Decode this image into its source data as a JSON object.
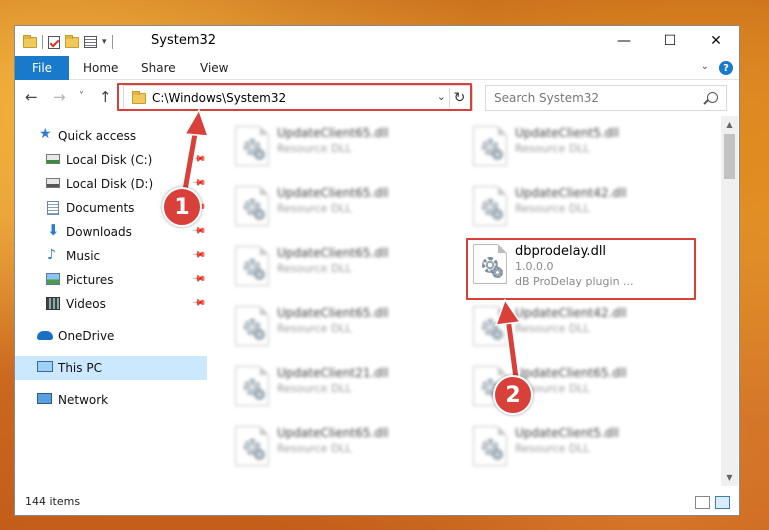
{
  "window": {
    "title": "System32",
    "minimize_glyph": "—",
    "maximize_glyph": "☐",
    "close_glyph": "✕"
  },
  "ribbon": {
    "file_label": "File",
    "tabs": [
      "Home",
      "Share",
      "View"
    ],
    "help_glyph": "?"
  },
  "address": {
    "path": "C:\\Windows\\System32",
    "back_glyph": "←",
    "forward_glyph": "→",
    "recent_glyph": "˅",
    "up_glyph": "↑",
    "dropdown_glyph": "⌄",
    "refresh_glyph": "↻"
  },
  "search": {
    "placeholder": "Search System32"
  },
  "sidebar": {
    "quick_access": "Quick access",
    "items": [
      {
        "label": "Local Disk (C:)",
        "icon": "drive-icon"
      },
      {
        "label": "Local Disk (D:)",
        "icon": "drive-icon"
      },
      {
        "label": "Documents",
        "icon": "documents-icon"
      },
      {
        "label": "Downloads",
        "icon": "downloads-icon"
      },
      {
        "label": "Music",
        "icon": "music-icon"
      },
      {
        "label": "Pictures",
        "icon": "pictures-icon"
      },
      {
        "label": "Videos",
        "icon": "videos-icon"
      }
    ],
    "onedrive": "OneDrive",
    "this_pc": "This PC",
    "network": "Network"
  },
  "files": {
    "left_column": [
      {
        "name": "UpdateClient65.dll",
        "type": "Resource DLL"
      },
      {
        "name": "UpdateClient65.dll",
        "type": "Resource DLL"
      },
      {
        "name": "UpdateClient65.dll",
        "type": "Resource DLL"
      },
      {
        "name": "UpdateClient65.dll",
        "type": "Resource DLL"
      },
      {
        "name": "UpdateClient21.dll",
        "type": "Resource DLL"
      },
      {
        "name": "UpdateClient65.dll",
        "type": "Resource DLL"
      }
    ],
    "right_column": [
      {
        "name": "UpdateClient5.dll",
        "type": "Resource DLL"
      },
      {
        "name": "UpdateClient42.dll",
        "type": "Resource DLL"
      },
      {
        "name": "dbprodelay.dll",
        "version": "1.0.0.0",
        "description": "dB ProDelay plugin ..."
      },
      {
        "name": "UpdateClient42.dll",
        "type": "Resource DLL"
      },
      {
        "name": "UpdateClient65.dll",
        "type": "Resource DLL"
      },
      {
        "name": "UpdateClient5.dll",
        "type": "Resource DLL"
      }
    ]
  },
  "status": {
    "item_count": "144 items"
  },
  "callouts": [
    "1",
    "2"
  ],
  "colors": {
    "accent": "#1979ca",
    "highlight": "#d9403a",
    "selection": "#cce8ff"
  }
}
